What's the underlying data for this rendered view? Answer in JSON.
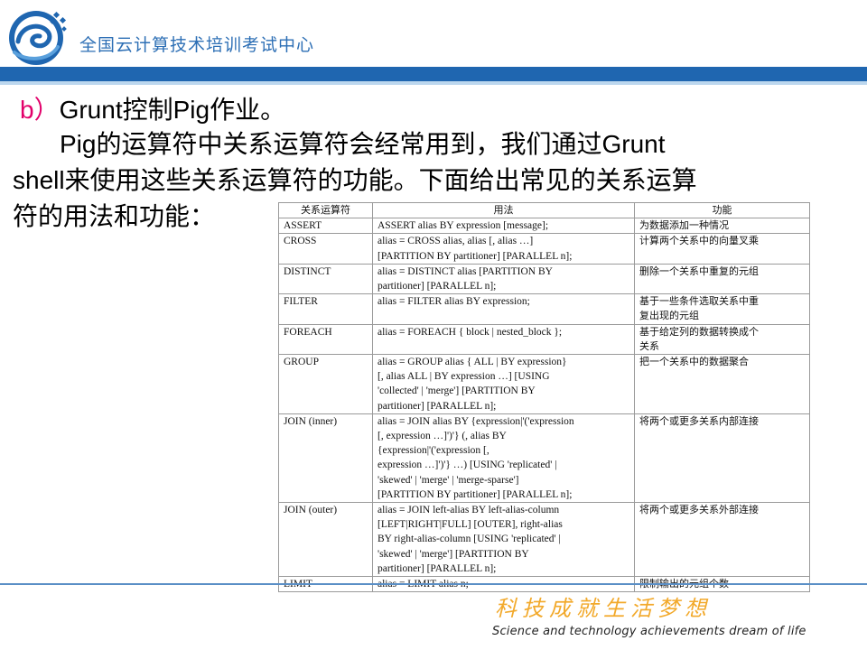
{
  "header": {
    "org_name": "全国云计算技术培训考试中心"
  },
  "content": {
    "heading_marker": "b）",
    "heading_text": "Grunt控制Pig作业。",
    "para_line1": "Pig的运算符中关系运算符会经常用到，我们通过Grunt",
    "para_line2": "shell来使用这些关系运算符的功能。下面给出常见的关系运算",
    "para_line3": "符的用法和功能："
  },
  "table": {
    "headers": [
      "关系运算符",
      "用法",
      "功能"
    ],
    "rows": [
      [
        "ASSERT",
        [
          "ASSERT alias BY expression [message];"
        ],
        [
          "为数据添加一种情况"
        ]
      ],
      [
        "CROSS",
        [
          "alias = CROSS alias, alias [, alias …]",
          "[PARTITION BY partitioner] [PARALLEL n];"
        ],
        [
          "计算两个关系中的向量叉乘"
        ]
      ],
      [
        "DISTINCT",
        [
          "alias = DISTINCT alias [PARTITION BY",
          "partitioner] [PARALLEL n];"
        ],
        [
          "删除一个关系中重复的元组"
        ]
      ],
      [
        "FILTER",
        [
          "alias = FILTER alias BY expression;"
        ],
        [
          "基于一些条件选取关系中重",
          "复出现的元组"
        ]
      ],
      [
        "FOREACH",
        [
          "alias   = FOREACH { block | nested_block };"
        ],
        [
          "基于给定列的数据转换成个",
          "关系"
        ]
      ],
      [
        "GROUP",
        [
          "alias = GROUP alias { ALL | BY expression}",
          "[, alias ALL | BY expression …] [USING",
          "'collected' | 'merge'] [PARTITION BY",
          "partitioner] [PARALLEL n];"
        ],
        [
          "把一个关系中的数据聚合"
        ]
      ],
      [
        "JOIN (inner)",
        [
          "alias = JOIN alias BY {expression|'('expression",
          "[, expression …]')'} (, alias BY",
          "{expression|'('expression [,",
          "expression …]')'} …) [USING 'replicated' |",
          "'skewed' | 'merge' | 'merge-sparse']",
          "[PARTITION BY partitioner] [PARALLEL n];"
        ],
        [
          "将两个或更多关系内部连接"
        ]
      ],
      [
        "JOIN (outer)",
        [
          "alias = JOIN left-alias BY left-alias-column",
          "[LEFT|RIGHT|FULL] [OUTER], right-alias",
          "BY right-alias-column [USING 'replicated' |",
          "'skewed' | 'merge'] [PARTITION BY",
          "partitioner] [PARALLEL n];"
        ],
        [
          "将两个或更多关系外部连接"
        ]
      ],
      [
        "LIMIT",
        [
          "alias = LIMIT alias    n;"
        ],
        [
          "限制输出的元组个数"
        ]
      ]
    ]
  },
  "footer": {
    "slogan_cn": "科技成就生活梦想",
    "slogan_en": "Science and technology achievements dream of life"
  },
  "colors": {
    "brand_blue": "#1f66b0",
    "marker_pink": "#e2006a",
    "slogan_orange": "#f2a92b"
  },
  "icons": {
    "logo": "cloud-swirl-logo-icon"
  }
}
